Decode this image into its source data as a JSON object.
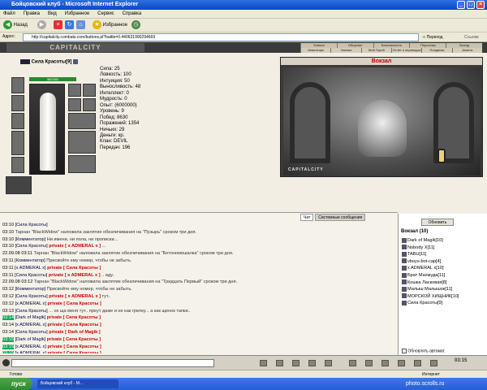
{
  "window": {
    "title": "Бойцовский клуб - Microsoft Internet Explorer"
  },
  "menu": [
    "Файл",
    "Правка",
    "Вид",
    "Избранное",
    "Сервис",
    "Справка"
  ],
  "toolbar": {
    "back": "Назад",
    "favorites": "Избранное"
  },
  "address": {
    "label": "Адрес:",
    "url": "http://capitalcity.combats.com/buttons.pl?battle=0.440631990294669",
    "go": "Переход",
    "links": "Ссылки"
  },
  "game": {
    "logo": "CAPITALCITY",
    "nav1": [
      "Знания",
      "Общение",
      "Безопасность",
      "Персонаж",
      "Выход"
    ],
    "nav2": [
      "Инвентарь",
      "Умения",
      "Мой Герой",
      "Отчёт о переводах",
      "Поединки",
      "Анкета"
    ],
    "character": {
      "name": "Сила Красоты",
      "level": "[9]",
      "hp": "382/382",
      "stats": [
        "Сила: 25",
        "Ловкость: 100",
        "Интуиция: 50",
        "Выносливость: 48",
        "Интеллект: 0",
        "Мудрость: 0"
      ],
      "stats2": [
        "Опыт:               (6000000)",
        "Уровень: 9",
        "Побед: 8630",
        "Поражений: 1354",
        "Ничьих: 29",
        "Деньги:              кр.",
        "Клан: DEVIL",
        "Передач: 196"
      ]
    },
    "location": {
      "title": "Вокзал",
      "label": "CAPITALCITY"
    },
    "chat_tabs": [
      "Чат",
      "Системные сообщения"
    ],
    "chat": [
      {
        "time": "03:10",
        "hl": false,
        "parts": [
          {
            "c": "nick",
            "t": "[Сила Красоты]"
          }
        ]
      },
      {
        "time": "03:10",
        "hl": false,
        "parts": [
          {
            "c": "sys",
            "t": "     Тарнан \"BlackWidow\" наложила заклятие обезличивания на \"Пузырь\" сроком три дня."
          }
        ]
      },
      {
        "time": "03:10",
        "hl": false,
        "parts": [
          {
            "c": "nick",
            "t": "[Комментатор]"
          },
          {
            "c": "sys",
            "t": " Ни имени, ни пола, ни прописки..."
          }
        ]
      },
      {
        "time": "03:10",
        "hl": false,
        "parts": [
          {
            "c": "nick",
            "t": "[Сила Красоты]"
          },
          {
            "c": "priv",
            "t": " private [ x ADMERAL x ]"
          },
          {
            "c": "sys",
            "t": " ..."
          }
        ]
      },
      {
        "time": "22.09.08 03:11",
        "hl": false,
        "parts": [
          {
            "c": "sys",
            "t": "     Тарнан \"BlackWidow\" наложила заклятие обезличивания на \"Бетономешалка\" сроком три дня."
          }
        ]
      },
      {
        "time": "03:11",
        "hl": false,
        "parts": [
          {
            "c": "nick",
            "t": "[Комментатор]"
          },
          {
            "c": "sys",
            "t": " Присвойте ему номер, чтобы не забыть."
          }
        ]
      },
      {
        "time": "03:11",
        "hl": false,
        "parts": [
          {
            "c": "nick",
            "t": "[x ADMERAL x]"
          },
          {
            "c": "priv",
            "t": " private [ Сила Красоты ]"
          }
        ]
      },
      {
        "time": "03:11",
        "hl": false,
        "parts": [
          {
            "c": "nick",
            "t": "[Сила Красоты]"
          },
          {
            "c": "priv",
            "t": " private [ x ADMERAL x ]"
          },
          {
            "c": "sys",
            "t": " .. иду.."
          }
        ]
      },
      {
        "time": "22.09.08 03:12",
        "hl": false,
        "parts": [
          {
            "c": "sys",
            "t": "     Тарнан \"BlackWidow\" наложила заклятие обезличивания на \"Тридцать Первый\" сроком три дня."
          }
        ]
      },
      {
        "time": "03:12",
        "hl": false,
        "parts": [
          {
            "c": "nick",
            "t": "[Комментатор]"
          },
          {
            "c": "sys",
            "t": " Присвойте ему номер, чтобы не забыть."
          }
        ]
      },
      {
        "time": "03:12",
        "hl": false,
        "parts": [
          {
            "c": "nick",
            "t": "[Сила Красоты]"
          },
          {
            "c": "priv",
            "t": " private [ x ADMERAL x ]"
          },
          {
            "c": "sys",
            "t": " тут.."
          }
        ]
      },
      {
        "time": "03:12",
        "hl": false,
        "parts": [
          {
            "c": "nick",
            "t": "[x ADMERAL x]"
          },
          {
            "c": "priv",
            "t": " private [ Сила Красоты ]"
          }
        ]
      },
      {
        "time": "03:13",
        "hl": false,
        "parts": [
          {
            "c": "nick",
            "t": "[Сила Красоты]"
          },
          {
            "c": "sys",
            "t": " ... ох ща меня тут.. прeут даже и не как грелку... а как щенок тапки.."
          }
        ]
      },
      {
        "time": "03:14",
        "hl": true,
        "parts": [
          {
            "c": "nick",
            "t": "[Dark of Magik]"
          },
          {
            "c": "priv",
            "t": " private [ Сила Красоты ]"
          }
        ]
      },
      {
        "time": "03:14",
        "hl": false,
        "parts": [
          {
            "c": "nick",
            "t": "[x ADMERAL x]"
          },
          {
            "c": "priv",
            "t": " private [ Сила Красоты ]"
          }
        ]
      },
      {
        "time": "03:14",
        "hl": false,
        "parts": [
          {
            "c": "nick",
            "t": "[Сила Красоты]"
          },
          {
            "c": "priv",
            "t": " private [ Dark of Magik ]"
          }
        ]
      },
      {
        "time": "03:15",
        "hl": true,
        "parts": [
          {
            "c": "nick",
            "t": "[Dark of Magik]"
          },
          {
            "c": "priv",
            "t": " private [ Сила Красоты ]"
          }
        ]
      },
      {
        "time": "03:15",
        "hl": true,
        "parts": [
          {
            "c": "nick",
            "t": "[x ADMERAL x]"
          },
          {
            "c": "priv",
            "t": " private [ Сила Красоты ]"
          }
        ]
      },
      {
        "time": "03:15",
        "hl": true,
        "parts": [
          {
            "c": "nick",
            "t": "[x ADMERAL x]"
          },
          {
            "c": "priv",
            "t": " private [ Сила Красоты ]"
          }
        ]
      },
      {
        "time": "03:15",
        "hl": true,
        "parts": [
          {
            "c": "nick",
            "t": "[Dark of Magik]"
          },
          {
            "c": "priv",
            "t": " private [ Сила Красоты ]"
          }
        ]
      },
      {
        "time": "03:15",
        "hl": true,
        "parts": [
          {
            "c": "nick",
            "t": "[Dark of Magik]"
          },
          {
            "c": "priv",
            "t": " private [ Сила Красоты ]"
          }
        ]
      }
    ],
    "online": {
      "refresh": "Обновить",
      "title": "Вокзал (10)",
      "users": [
        "Dark of Magik[10]",
        "Nobody X[11]",
        "TABU[11]",
        "vboys-bot-cap[4]",
        "x ADMERAL x[10]",
        "Брат Махмуда[11]",
        "Кошка Ласковая[8]",
        "Малыш Малышок[11]",
        "МОРСКОЙ ХИЩНИК[10]",
        "Сила Красоты[9]"
      ],
      "auto": "Обновлять автомат."
    },
    "clock": "03:15"
  },
  "status": {
    "left": "Готово",
    "right": "Интернет"
  },
  "taskbar": {
    "start": "пуск",
    "item": "Бойцовский клуб - M...",
    "watermark": "photo.scrolls.ru"
  }
}
